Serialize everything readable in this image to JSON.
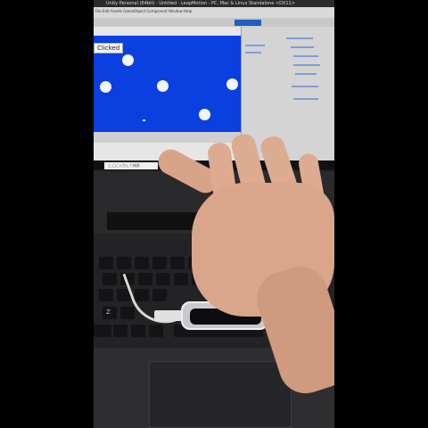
{
  "photo": {
    "subject": "",
    "colors": {
      "game_background": "#0a3fe0",
      "ball": "#f2f5ff",
      "skin": "#d9a68b",
      "laptop": "#232325"
    }
  },
  "monitor": {
    "window_title": "Unity Personal (64bit) - Untitled - LeapMotion - PC, Mac & Linux Standalone <DX11>",
    "menu_text": "File  Edit  Assets  GameObject  Component  Window  Help",
    "game_view": {
      "click_label": "Clicked",
      "balls": 6
    },
    "taskbar": {
      "search_placeholder": "ここに入力して検索"
    }
  },
  "keyboard": {
    "visible_keys": [
      "Z",
      "Z",
      "Ctrl",
      "Fn"
    ]
  }
}
